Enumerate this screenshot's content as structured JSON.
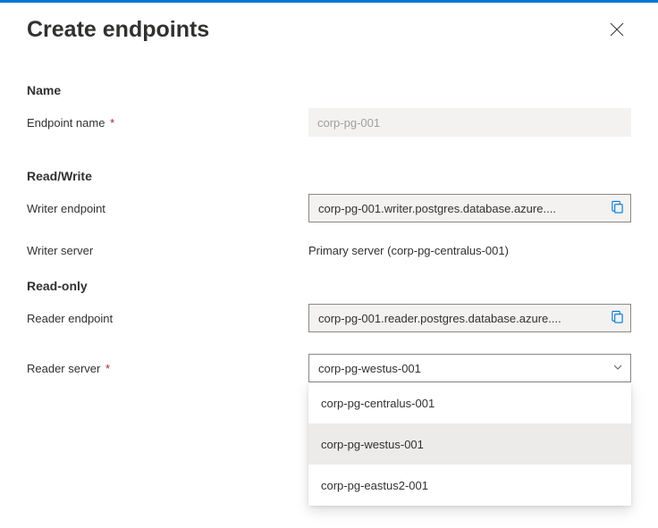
{
  "header": {
    "title": "Create endpoints"
  },
  "sections": {
    "name": {
      "label": "Name",
      "endpoint_name": {
        "label": "Endpoint name",
        "value": "",
        "placeholder": "corp-pg-001"
      }
    },
    "read_write": {
      "label": "Read/Write",
      "writer_endpoint": {
        "label": "Writer endpoint",
        "value": "corp-pg-001.writer.postgres.database.azure...."
      },
      "writer_server": {
        "label": "Writer server",
        "value": "Primary server (corp-pg-centralus-001)"
      }
    },
    "read_only": {
      "label": "Read-only",
      "reader_endpoint": {
        "label": "Reader endpoint",
        "value": "corp-pg-001.reader.postgres.database.azure...."
      },
      "reader_server": {
        "label": "Reader server",
        "selected": "corp-pg-westus-001",
        "options": [
          "corp-pg-centralus-001",
          "corp-pg-westus-001",
          "corp-pg-eastus2-001"
        ]
      }
    }
  },
  "colors": {
    "accent": "#0078d4",
    "required": "#a4262c"
  }
}
